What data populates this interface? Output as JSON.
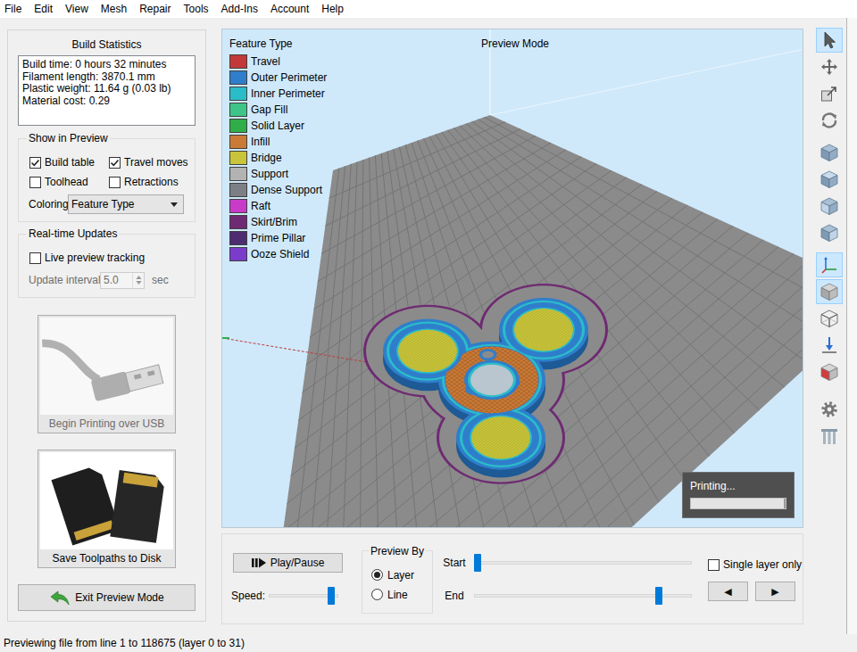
{
  "window": {
    "menu": [
      "File",
      "Edit",
      "View",
      "Mesh",
      "Repair",
      "Tools",
      "Add-Ins",
      "Account",
      "Help"
    ]
  },
  "build_statistics": {
    "title": "Build Statistics",
    "lines": [
      "Build time: 0 hours 32 minutes",
      "Filament length: 3870.1 mm",
      "Plastic weight: 11.64 g (0.03 lb)",
      "Material cost: 0.29"
    ]
  },
  "show_in_preview": {
    "title": "Show in Preview",
    "options": [
      {
        "label": "Build table",
        "checked": true
      },
      {
        "label": "Travel moves",
        "checked": true
      },
      {
        "label": "Toolhead",
        "checked": false
      },
      {
        "label": "Retractions",
        "checked": false
      }
    ],
    "coloring": {
      "label": "Coloring",
      "value": "Feature Type"
    }
  },
  "realtime_updates": {
    "title": "Real-time Updates",
    "live_tracking": {
      "label": "Live preview tracking",
      "checked": false
    },
    "interval": {
      "label": "Update interval",
      "value": "5.0",
      "unit": "sec",
      "disabled": true
    }
  },
  "print_actions": [
    {
      "label": "Begin Printing over USB",
      "kind": "usb",
      "disabled": true
    },
    {
      "label": "Save Toolpaths to Disk",
      "kind": "sd",
      "disabled": false
    }
  ],
  "exit_button": {
    "label": "Exit Preview Mode"
  },
  "viewport": {
    "title": "Preview Mode",
    "legend_title": "Feature Type",
    "legend": [
      {
        "label": "Travel",
        "color": "#c3393a"
      },
      {
        "label": "Outer Perimeter",
        "color": "#2f7ecb"
      },
      {
        "label": "Inner Perimeter",
        "color": "#2bbcc9"
      },
      {
        "label": "Gap Fill",
        "color": "#3ec488"
      },
      {
        "label": "Solid Layer",
        "color": "#2fae49"
      },
      {
        "label": "Infill",
        "color": "#c97a37"
      },
      {
        "label": "Bridge",
        "color": "#c9c53a"
      },
      {
        "label": "Support",
        "color": "#b3b3b3"
      },
      {
        "label": "Dense Support",
        "color": "#7c8086"
      },
      {
        "label": "Raft",
        "color": "#c83ac8"
      },
      {
        "label": "Skirt/Brim",
        "color": "#6e2a72"
      },
      {
        "label": "Prime Pillar",
        "color": "#4e2c72"
      },
      {
        "label": "Ooze Shield",
        "color": "#7b3ccc"
      }
    ],
    "progress": {
      "label": "Printing...",
      "level": 0.98
    }
  },
  "playback": {
    "play_pause": "Play/Pause",
    "speed": {
      "label": "Speed:",
      "level": 0.94
    },
    "preview_by": {
      "title": "Preview By",
      "options": [
        {
          "label": "Layer",
          "selected": true
        },
        {
          "label": "Line",
          "selected": false
        }
      ]
    },
    "range": [
      {
        "label": "Start",
        "level": 0.0
      },
      {
        "label": "End",
        "level": 0.86
      }
    ],
    "single_layer": {
      "label": "Single layer only",
      "checked": false
    },
    "step_buttons": [
      "◀",
      "▶"
    ]
  },
  "toolbar": [
    [
      {
        "kind": "pointer",
        "selected": true
      },
      {
        "kind": "move",
        "selected": false
      },
      {
        "kind": "scale",
        "selected": false
      },
      {
        "kind": "rotate",
        "selected": false
      }
    ],
    [
      {
        "kind": "cube-iso",
        "selected": false
      },
      {
        "kind": "cube-top",
        "selected": false
      },
      {
        "kind": "cube-front",
        "selected": false
      },
      {
        "kind": "cube-side",
        "selected": false
      }
    ],
    [
      {
        "kind": "axes",
        "selected": true
      },
      {
        "kind": "solid",
        "selected": true
      },
      {
        "kind": "wireframe",
        "selected": false
      },
      {
        "kind": "drop",
        "selected": false
      },
      {
        "kind": "section",
        "selected": false
      }
    ],
    [
      {
        "kind": "settings",
        "selected": false
      },
      {
        "kind": "supports",
        "selected": false
      }
    ]
  ],
  "status_bar": "Previewing file from line 1 to 118675 (layer 0 to 31)"
}
